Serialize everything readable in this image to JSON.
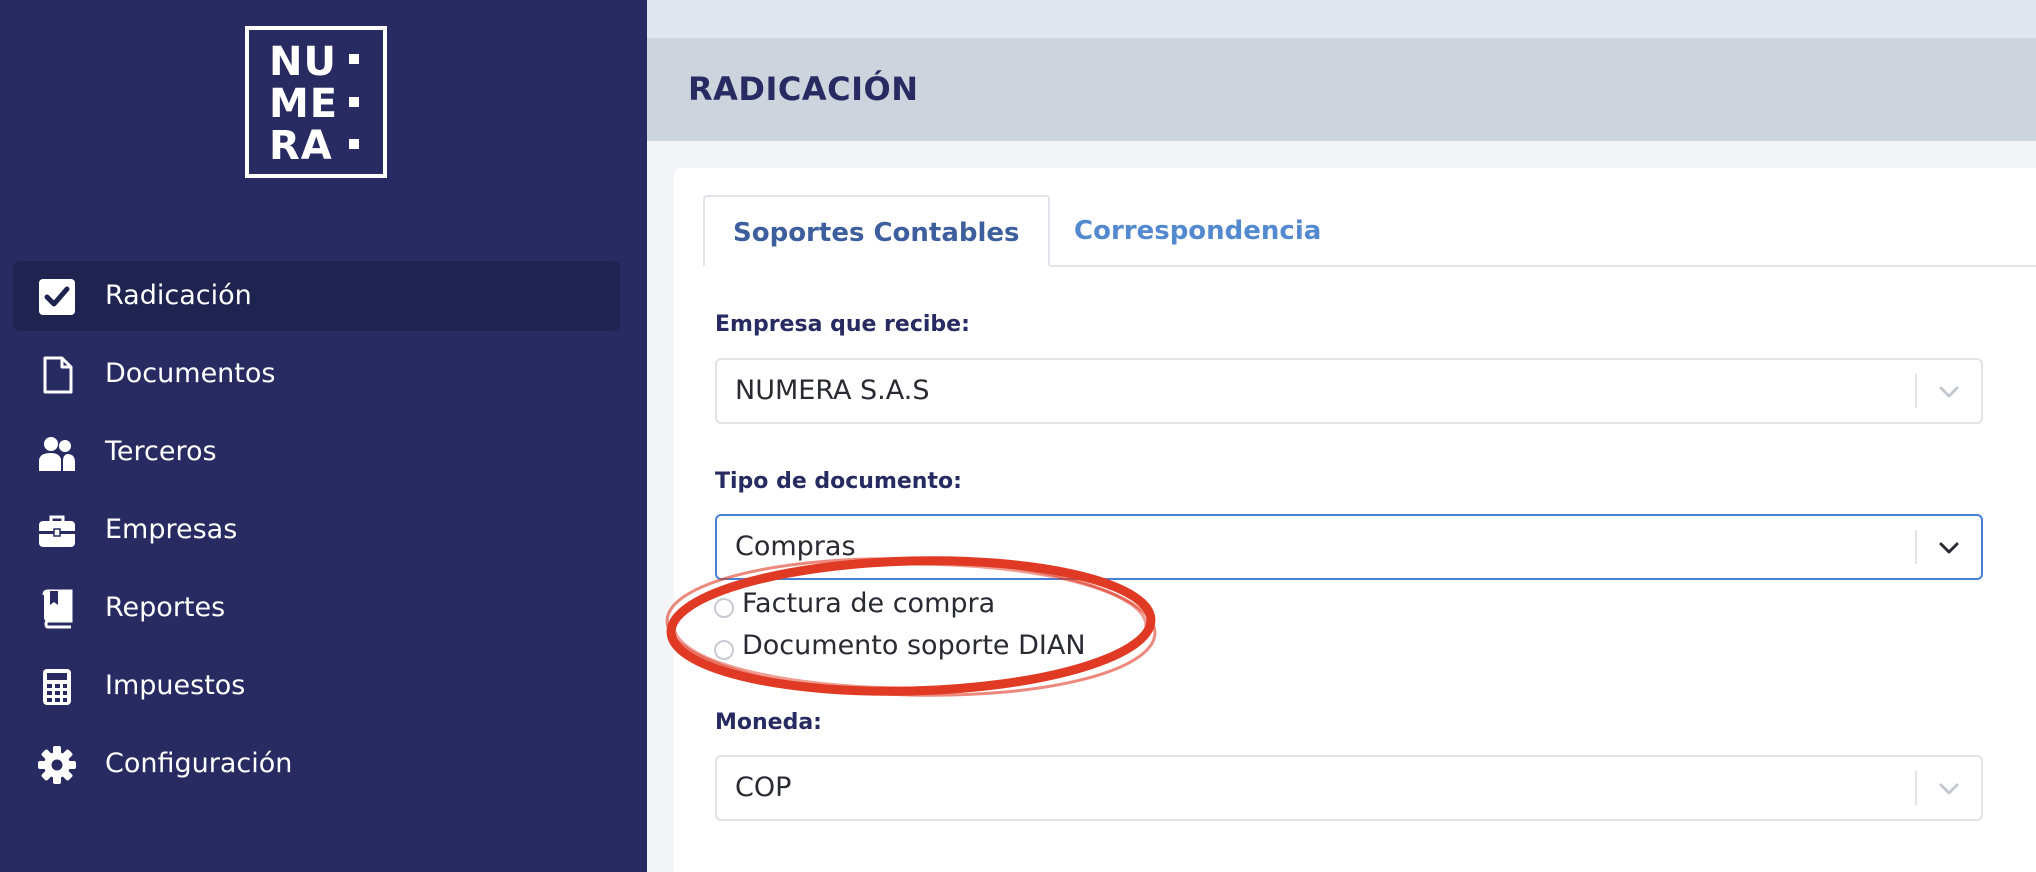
{
  "brand": {
    "logo_lines": [
      "NU",
      "ME",
      "RA"
    ]
  },
  "sidebar": {
    "items": [
      {
        "label": "Radicación",
        "icon": "check-square-icon",
        "active": true
      },
      {
        "label": "Documentos",
        "icon": "file-icon",
        "active": false
      },
      {
        "label": "Terceros",
        "icon": "users-icon",
        "active": false
      },
      {
        "label": "Empresas",
        "icon": "briefcase-icon",
        "active": false
      },
      {
        "label": "Reportes",
        "icon": "book-icon",
        "active": false
      },
      {
        "label": "Impuestos",
        "icon": "calculator-icon",
        "active": false
      },
      {
        "label": "Configuración",
        "icon": "gear-icon",
        "active": false
      }
    ]
  },
  "header": {
    "title": "RADICACIÓN"
  },
  "tabs": [
    {
      "label": "Soportes Contables",
      "active": true
    },
    {
      "label": "Correspondencia",
      "active": false
    }
  ],
  "form": {
    "empresa": {
      "label": "Empresa que recibe:",
      "value": "NUMERA S.A.S"
    },
    "tipo_documento": {
      "label": "Tipo de documento:",
      "value": "Compras",
      "options": [
        {
          "label": "Factura de compra",
          "checked": false
        },
        {
          "label": "Documento soporte DIAN",
          "checked": false
        }
      ]
    },
    "moneda": {
      "label": "Moneda:",
      "value": "COP"
    }
  },
  "colors": {
    "sidebar_bg": "#272b61",
    "sidebar_active": "#1f2350",
    "accent_blue": "#5289cf",
    "focus_border": "#4a7fd6",
    "annotation_red": "#e03a25"
  }
}
